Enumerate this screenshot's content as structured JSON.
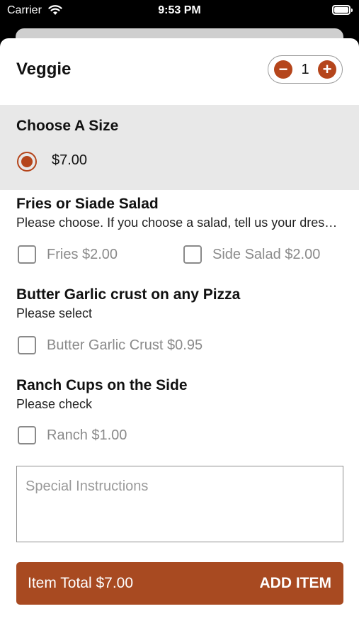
{
  "status": {
    "carrier": "Carrier",
    "time": "9:53 PM"
  },
  "item": {
    "title": "Veggie",
    "quantity": "1"
  },
  "size": {
    "heading": "Choose A Size",
    "option": "$7.00"
  },
  "groups": [
    {
      "title": "Fries or Siade Salad",
      "subtitle": "Please choose.  If you choose a salad, tell us your dressing choice in the special instructions",
      "options": [
        "Fries $2.00",
        "Side Salad $2.00"
      ]
    },
    {
      "title": "Butter Garlic crust on any Pizza",
      "subtitle": "Please select",
      "options": [
        "Butter Garlic Crust $0.95"
      ]
    },
    {
      "title": "Ranch Cups on the Side",
      "subtitle": "Please check",
      "options": [
        "Ranch $1.00"
      ]
    }
  ],
  "instructions": {
    "placeholder": "Special Instructions"
  },
  "footer": {
    "total": "Item Total $7.00",
    "add_label": "ADD ITEM"
  },
  "colors": {
    "accent": "#b5451b",
    "button": "#a84a21"
  },
  "icons": {
    "wifi": "wifi-icon",
    "battery": "battery-icon",
    "minus": "minus-icon",
    "plus": "plus-icon"
  }
}
